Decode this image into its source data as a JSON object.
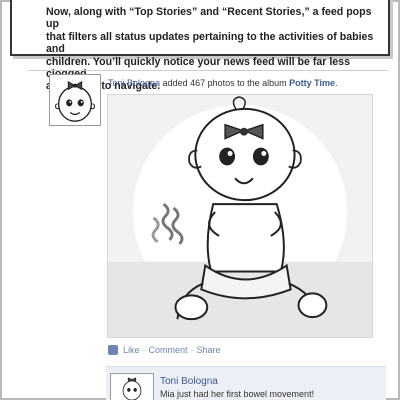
{
  "caption": {
    "lines": [
      "Now, along with “Top Stories” and “Recent Stories,” a feed pops up",
      "that filters all status updates pertaining to the activities of babies and",
      "children.  You’ll quickly notice your news feed will be far less clogged",
      "and easier to navigate."
    ]
  },
  "story": {
    "author": "Toni Bologna",
    "action_text": " added 467 photos to the album ",
    "album": "Potty Time",
    "end_punct": "."
  },
  "photo": {
    "icon": "cartoon-baby-on-potty"
  },
  "actions": {
    "like": "Like",
    "separator": "·",
    "comment": "Comment",
    "share": "Share"
  },
  "comment": {
    "author": "Toni Bologna",
    "text": "Mia just had her first bowel movement!"
  },
  "colors": {
    "link": "#3b5998",
    "action_link": "#6d84b4",
    "comment_bg": "#eceff5"
  }
}
